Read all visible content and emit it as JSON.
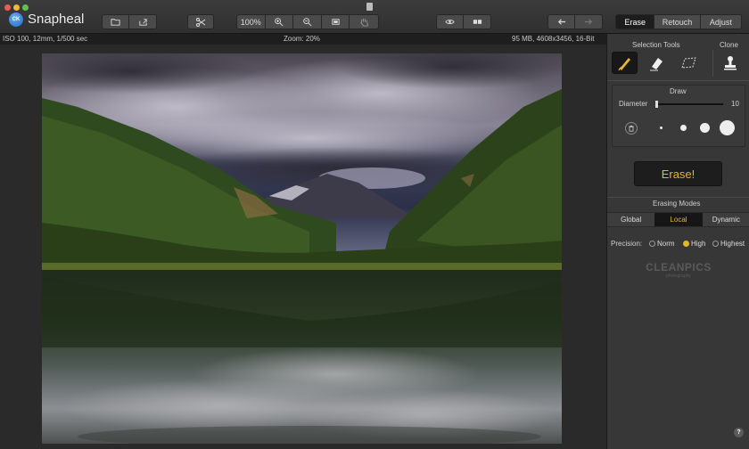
{
  "app": {
    "title": "Snapheal",
    "icon_text": "CK"
  },
  "toolbar": {
    "zoom_button": "100%",
    "panel_tabs": [
      "Erase",
      "Retouch",
      "Adjust"
    ],
    "active_panel_tab": "Erase",
    "icons": [
      "folder-icon",
      "share-icon",
      "scissors-icon",
      "zoom-in-icon",
      "zoom-out-icon",
      "fit-icon",
      "hand-icon",
      "eye-icon",
      "compare-icon",
      "undo-icon",
      "redo-icon"
    ]
  },
  "infobar": {
    "exif": "ISO 100, 12mm, 1/500 sec",
    "zoom": "Zoom: 20%",
    "file_info": "95 MB, 4608x3456, 16-Bit"
  },
  "panel": {
    "selection_tools_title": "Selection Tools",
    "clone_title": "Clone",
    "draw_title": "Draw",
    "diameter_label": "Diameter",
    "diameter_value": "10",
    "erase_button": "Erase!",
    "erasing_modes_title": "Erasing Modes",
    "modes": [
      "Global",
      "Local",
      "Dynamic"
    ],
    "active_mode": "Local",
    "precision_label": "Precision:",
    "precision_options": [
      "Norm",
      "High",
      "Highest"
    ],
    "active_precision": "High",
    "help": "?"
  },
  "watermark": {
    "line1": "CLEANPICS",
    "line2": "photography"
  },
  "colors": {
    "accent": "#e5b52b",
    "panel_bg": "#373737",
    "toolbar_bg": "#3c3c3c"
  }
}
